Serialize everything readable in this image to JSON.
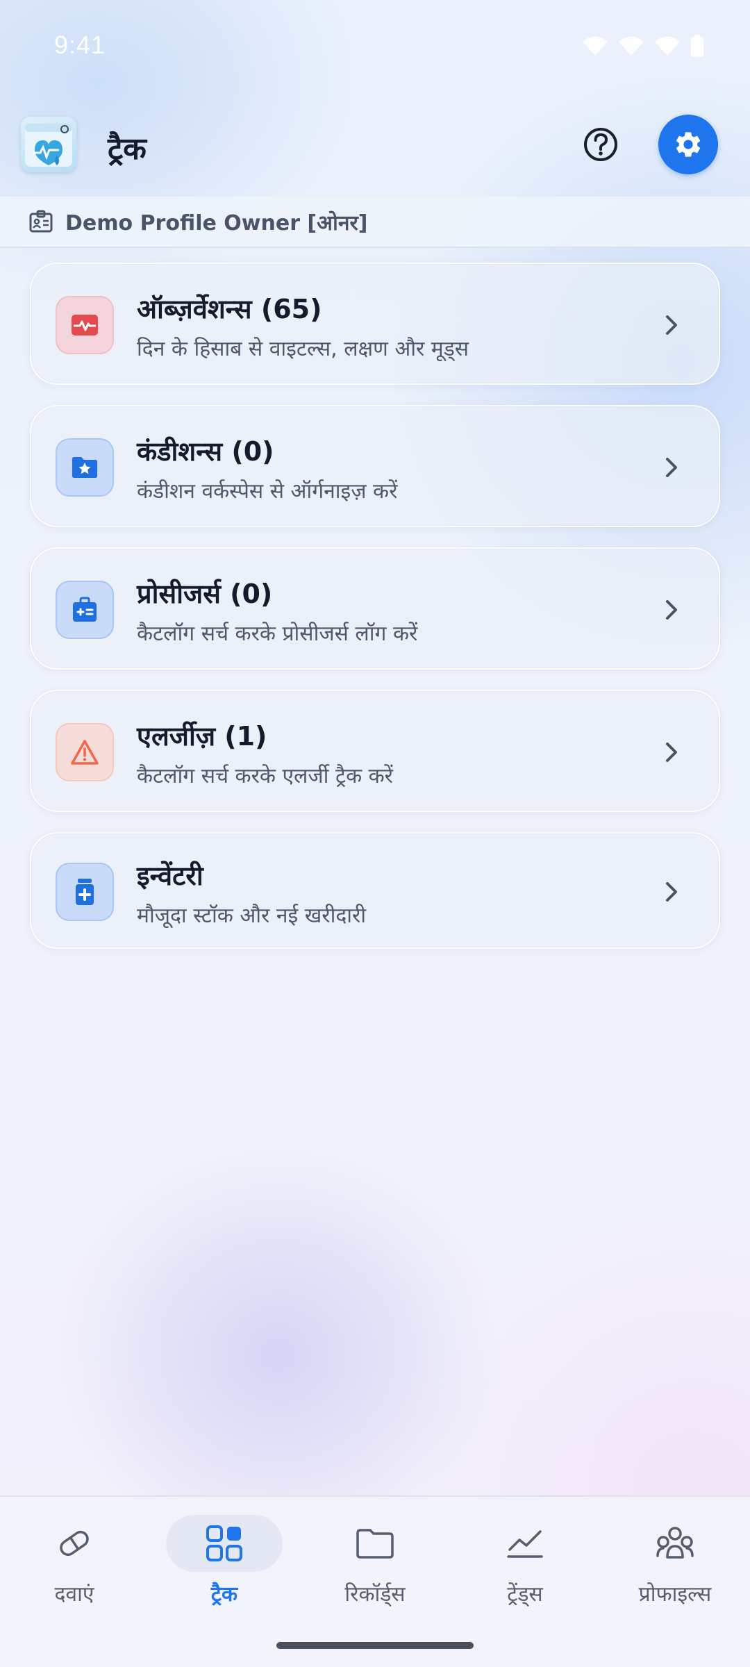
{
  "status_bar": {
    "time": "9:41"
  },
  "header": {
    "title": "ट्रैक"
  },
  "profile": {
    "name": "Demo Profile Owner [ओनर]"
  },
  "cards": [
    {
      "title": "ऑब्ज़र्वेशन्स (65)",
      "subtitle": "दिन के हिसाब से वाइटल्स, लक्षण और मूड्स",
      "icon": "vitals-icon"
    },
    {
      "title": "कंडीशन्स (0)",
      "subtitle": "कंडीशन वर्कस्पेस से ऑर्गनाइज़ करें",
      "icon": "folder-star-icon"
    },
    {
      "title": "प्रोसीजर्स (0)",
      "subtitle": "कैटलॉग सर्च करके प्रोसीजर्स लॉग करें",
      "icon": "medical-kit-icon"
    },
    {
      "title": "एलर्जीज़ (1)",
      "subtitle": "कैटलॉग सर्च करके एलर्जी ट्रैक करें",
      "icon": "warning-icon"
    },
    {
      "title": "इन्वेंटरी",
      "subtitle": "मौजूदा स्टॉक और नई खरीदारी",
      "icon": "medicine-bottle-icon"
    }
  ],
  "nav": [
    {
      "label": "दवाएं",
      "icon": "pill-icon",
      "active": false
    },
    {
      "label": "ट्रैक",
      "icon": "grid-icon",
      "active": true
    },
    {
      "label": "रिकॉर्ड्स",
      "icon": "folder-icon",
      "active": false
    },
    {
      "label": "ट्रेंड्स",
      "icon": "trend-line-icon",
      "active": false
    },
    {
      "label": "प्रोफाइल्स",
      "icon": "profiles-icon",
      "active": false
    }
  ],
  "colors": {
    "accent": "#1f75ee",
    "vitals": "#e5484d",
    "warning": "#f0674a"
  }
}
